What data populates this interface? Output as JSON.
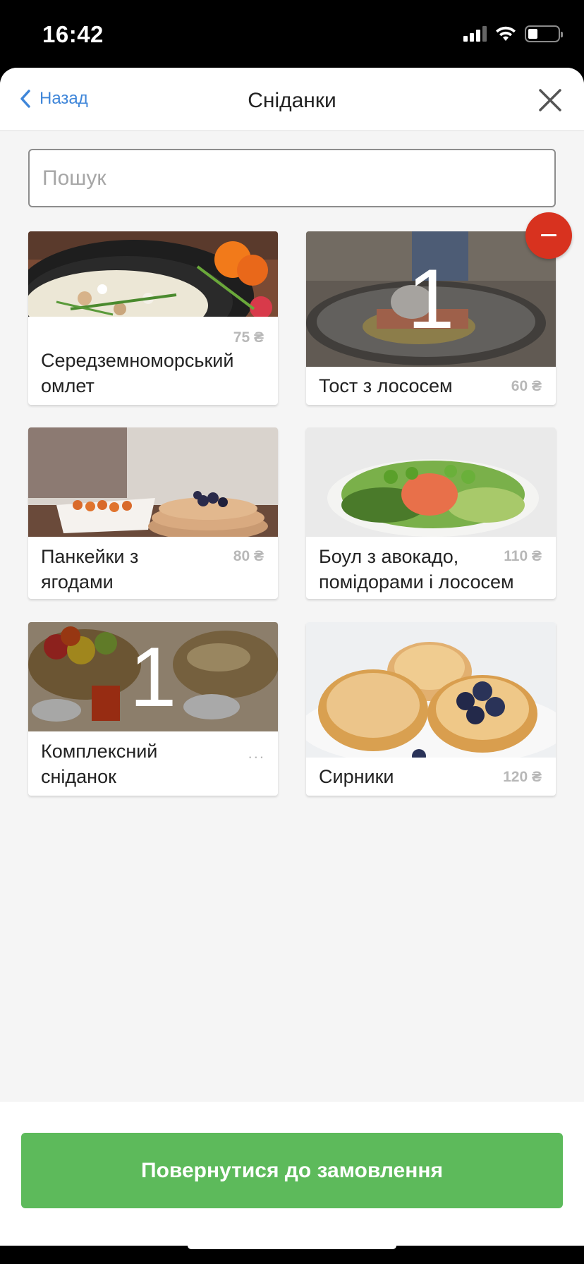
{
  "status_bar": {
    "time": "16:42"
  },
  "nav": {
    "back_label": "Назад",
    "title": "Сніданки"
  },
  "search": {
    "placeholder": "Пошук",
    "value": ""
  },
  "items": [
    {
      "name": "Середземноморський омлет",
      "price": "75 ₴",
      "quantity": ""
    },
    {
      "name": "Тост з лососем",
      "price": "60 ₴",
      "quantity": "1"
    },
    {
      "name": "Панкейки з ягодами",
      "price": "80 ₴",
      "quantity": ""
    },
    {
      "name": "Боул з авокадо, помідорами і лососем",
      "price": "110 ₴",
      "quantity": ""
    },
    {
      "name": "Комплексний сніданок",
      "price": "...",
      "quantity": "1"
    },
    {
      "name": "Сирники",
      "price": "120 ₴",
      "quantity": ""
    }
  ],
  "footer": {
    "button_label": "Повернутися до замовлення"
  },
  "colors": {
    "accent_blue": "#3f86d9",
    "button_green": "#5dba5b",
    "remove_red": "#d8321f"
  }
}
